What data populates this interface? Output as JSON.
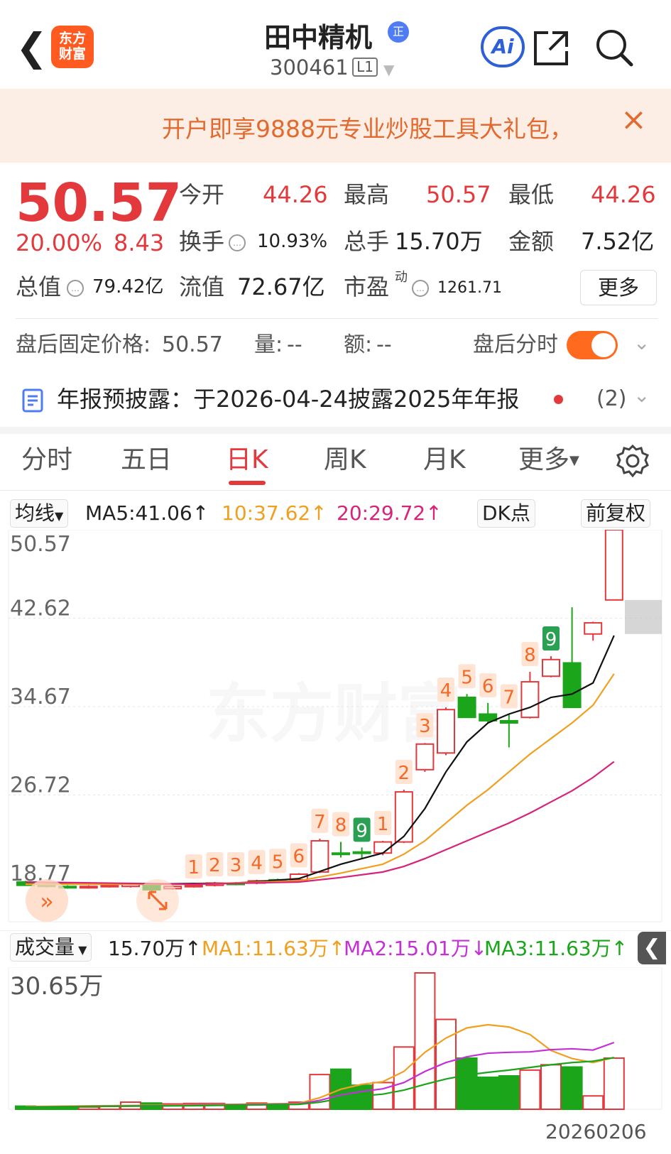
{
  "header": {
    "back_icon": "chevron-left-icon",
    "logo_line1": "东方",
    "logo_line2": "财富",
    "title": "田中精机",
    "badge": "正",
    "code": "300461",
    "level": "L1",
    "ai_label": "Ai",
    "share_icon": "share-icon",
    "search_icon": "search-icon"
  },
  "banner": {
    "text": "开户即享9888元专业炒股工具大礼包，",
    "close": "×"
  },
  "quote": {
    "price": "50.57",
    "change_pct": "20.00%",
    "change": "8.43",
    "open_label": "今开",
    "open": "44.26",
    "high_label": "最高",
    "high": "50.57",
    "low_label": "最低",
    "low": "44.26",
    "turnover_label": "换手",
    "turnover": "10.93%",
    "volume_label": "总手",
    "volume": "15.70万",
    "amount_label": "金额",
    "amount": "7.52亿",
    "mktcap_label": "总值",
    "mktcap": "79.42亿",
    "float_label": "流值",
    "float_cap": "72.67亿",
    "pe_label": "市盈",
    "pe_sup": "动",
    "pe": "1261.71",
    "more": "更多"
  },
  "after_hours": {
    "label": "盘后固定价格:",
    "price": "50.57",
    "vol_label": "量:",
    "vol": "--",
    "amt_label": "额:",
    "amt": "--",
    "timeshare_label": "盘后分时"
  },
  "disclosure": {
    "text": "年报预披露：于2026-04-24披露2025年年报",
    "count": "(2)"
  },
  "tabs": [
    "分时",
    "五日",
    "日K",
    "周K",
    "月K",
    "更多"
  ],
  "ma_bar": {
    "selector": "均线",
    "ma5": "MA5:41.06↑",
    "ma10": "10:37.62↑",
    "ma20": "20:29.72↑",
    "dk": "DK点",
    "adjust": "前复权"
  },
  "vol_bar": {
    "selector": "成交量",
    "current": "15.70万↑",
    "ma1": "MA1:11.63万↑",
    "ma2": "MA2:15.01万↓",
    "ma3": "MA3:11.63万↑"
  },
  "watermark": "东方财富",
  "date": "20260206",
  "colors": {
    "up": "#e4393c",
    "down": "#1aa51a",
    "ma5": "#111111",
    "ma10": "#f0a020",
    "ma20": "#d6247a",
    "seq_up": "#f26a2a",
    "seq_down": "#2aa052"
  },
  "chart_data": {
    "type": "candlestick",
    "y_ticks": [
      "50.57",
      "42.62",
      "34.67",
      "26.72",
      "18.77"
    ],
    "ylim": [
      18.77,
      50.57
    ],
    "vol_tick": "30.65万",
    "vol_max": 30.65,
    "candles": [
      {
        "o": 18.9,
        "h": 19.0,
        "l": 18.6,
        "c": 18.6,
        "v": 0.7,
        "d": 1
      },
      {
        "o": 18.7,
        "h": 18.8,
        "l": 18.4,
        "c": 18.5,
        "v": 0.6,
        "d": 1
      },
      {
        "o": 18.5,
        "h": 18.6,
        "l": 18.3,
        "c": 18.4,
        "v": 0.6,
        "d": 1
      },
      {
        "o": 18.4,
        "h": 18.6,
        "l": 18.3,
        "c": 18.5,
        "v": 0.5,
        "d": 0
      },
      {
        "o": 18.5,
        "h": 18.7,
        "l": 18.4,
        "c": 18.6,
        "v": 0.7,
        "d": 0
      },
      {
        "o": 18.5,
        "h": 18.8,
        "l": 18.4,
        "c": 18.7,
        "v": 1.6,
        "d": 0
      },
      {
        "o": 18.6,
        "h": 18.7,
        "l": 18.1,
        "c": 18.2,
        "v": 1.4,
        "d": 1
      },
      {
        "o": 18.3,
        "h": 18.6,
        "l": 18.2,
        "c": 18.5,
        "v": 1.2,
        "d": 0
      },
      {
        "o": 18.5,
        "h": 18.7,
        "l": 18.4,
        "c": 18.6,
        "v": 1.3,
        "d": 0
      },
      {
        "o": 18.6,
        "h": 18.9,
        "l": 18.5,
        "c": 18.8,
        "v": 1.3,
        "d": 0
      },
      {
        "o": 18.8,
        "h": 18.9,
        "l": 18.6,
        "c": 18.7,
        "v": 1.1,
        "d": 1
      },
      {
        "o": 18.8,
        "h": 19.1,
        "l": 18.7,
        "c": 19.0,
        "v": 1.4,
        "d": 0
      },
      {
        "o": 19.0,
        "h": 19.2,
        "l": 18.9,
        "c": 19.1,
        "v": 1.2,
        "d": 1
      },
      {
        "o": 19.1,
        "h": 19.7,
        "l": 19.0,
        "c": 19.6,
        "v": 1.6,
        "d": 0
      },
      {
        "o": 19.8,
        "h": 22.8,
        "l": 19.7,
        "c": 22.6,
        "v": 7.8,
        "d": 0
      },
      {
        "o": 21.5,
        "h": 22.5,
        "l": 21.1,
        "c": 21.5,
        "v": 9.0,
        "d": 1
      },
      {
        "o": 21.6,
        "h": 22.0,
        "l": 21.0,
        "c": 21.6,
        "v": 5.4,
        "d": 1
      },
      {
        "o": 21.5,
        "h": 22.6,
        "l": 21.3,
        "c": 22.5,
        "v": 6.0,
        "d": 0
      },
      {
        "o": 22.5,
        "h": 27.2,
        "l": 22.4,
        "c": 27.0,
        "v": 14.0,
        "d": 0
      },
      {
        "o": 29.0,
        "h": 31.4,
        "l": 28.8,
        "c": 31.3,
        "v": 30.65,
        "d": 0
      },
      {
        "o": 30.5,
        "h": 34.6,
        "l": 30.3,
        "c": 34.4,
        "v": 20.2,
        "d": 0
      },
      {
        "o": 35.5,
        "h": 35.8,
        "l": 33.7,
        "c": 33.7,
        "v": 11.5,
        "d": 1
      },
      {
        "o": 34.0,
        "h": 35.0,
        "l": 33.2,
        "c": 33.4,
        "v": 7.2,
        "d": 1
      },
      {
        "o": 33.4,
        "h": 34.0,
        "l": 31.0,
        "c": 33.2,
        "v": 7.5,
        "d": 1
      },
      {
        "o": 33.7,
        "h": 37.8,
        "l": 33.6,
        "c": 36.9,
        "v": 8.8,
        "d": 0
      },
      {
        "o": 37.4,
        "h": 39.2,
        "l": 37.3,
        "c": 38.9,
        "v": 10.0,
        "d": 0
      },
      {
        "o": 38.6,
        "h": 43.6,
        "l": 34.6,
        "c": 34.6,
        "v": 9.5,
        "d": 1
      },
      {
        "o": 41.2,
        "h": 42.3,
        "l": 40.6,
        "c": 42.2,
        "v": 3.0,
        "d": 0
      },
      {
        "o": 44.26,
        "h": 50.57,
        "l": 44.26,
        "c": 50.57,
        "v": 11.5,
        "d": 0
      }
    ],
    "labels": [
      {
        "i": 8,
        "t": "1",
        "k": "up"
      },
      {
        "i": 9,
        "t": "2",
        "k": "up"
      },
      {
        "i": 10,
        "t": "3",
        "k": "up"
      },
      {
        "i": 11,
        "t": "4",
        "k": "up"
      },
      {
        "i": 12,
        "t": "5",
        "k": "up"
      },
      {
        "i": 13,
        "t": "6",
        "k": "up"
      },
      {
        "i": 14,
        "t": "7",
        "k": "up"
      },
      {
        "i": 15,
        "t": "8",
        "k": "up"
      },
      {
        "i": 16,
        "t": "9",
        "k": "down"
      },
      {
        "i": 17,
        "t": "1",
        "k": "up"
      },
      {
        "i": 18,
        "t": "2",
        "k": "up"
      },
      {
        "i": 19,
        "t": "3",
        "k": "up"
      },
      {
        "i": 20,
        "t": "4",
        "k": "up"
      },
      {
        "i": 21,
        "t": "5",
        "k": "up"
      },
      {
        "i": 22,
        "t": "6",
        "k": "up"
      },
      {
        "i": 23,
        "t": "7",
        "k": "up"
      },
      {
        "i": 24,
        "t": "8",
        "k": "up"
      },
      {
        "i": 25,
        "t": "9",
        "k": "down"
      }
    ],
    "ma5": [
      [
        0,
        18.9
      ],
      [
        5,
        18.7
      ],
      [
        10,
        18.8
      ],
      [
        13,
        19.2
      ],
      [
        15,
        20.5
      ],
      [
        17,
        21.5
      ],
      [
        18,
        23.0
      ],
      [
        19,
        25.5
      ],
      [
        20,
        28.8
      ],
      [
        21,
        31.5
      ],
      [
        22,
        33.2
      ],
      [
        23,
        34.0
      ],
      [
        24,
        34.6
      ],
      [
        25,
        35.5
      ],
      [
        26,
        35.8
      ],
      [
        27,
        36.8
      ],
      [
        28,
        41.06
      ]
    ],
    "ma10": [
      [
        0,
        18.7
      ],
      [
        8,
        18.7
      ],
      [
        13,
        19.0
      ],
      [
        15,
        19.7
      ],
      [
        17,
        20.5
      ],
      [
        18,
        21.4
      ],
      [
        19,
        22.6
      ],
      [
        20,
        24.2
      ],
      [
        21,
        25.8
      ],
      [
        22,
        27.2
      ],
      [
        23,
        28.8
      ],
      [
        24,
        30.4
      ],
      [
        25,
        31.8
      ],
      [
        26,
        33.2
      ],
      [
        27,
        34.8
      ],
      [
        28,
        37.62
      ]
    ],
    "ma20": [
      [
        0,
        18.9
      ],
      [
        8,
        18.7
      ],
      [
        13,
        18.9
      ],
      [
        15,
        19.3
      ],
      [
        17,
        19.8
      ],
      [
        18,
        20.3
      ],
      [
        19,
        21.0
      ],
      [
        20,
        21.8
      ],
      [
        21,
        22.6
      ],
      [
        22,
        23.4
      ],
      [
        23,
        24.2
      ],
      [
        24,
        25.1
      ],
      [
        25,
        26.1
      ],
      [
        26,
        27.1
      ],
      [
        27,
        28.3
      ],
      [
        28,
        29.72
      ]
    ],
    "vma1": [
      [
        0,
        0.6
      ],
      [
        8,
        1.0
      ],
      [
        13,
        1.3
      ],
      [
        14,
        2.6
      ],
      [
        15,
        4.5
      ],
      [
        16,
        5.6
      ],
      [
        17,
        6.2
      ],
      [
        18,
        8.5
      ],
      [
        19,
        12.8
      ],
      [
        20,
        16.0
      ],
      [
        21,
        18.3
      ],
      [
        22,
        19.0
      ],
      [
        23,
        18.5
      ],
      [
        24,
        16.8
      ],
      [
        25,
        13.2
      ],
      [
        26,
        11.4
      ],
      [
        27,
        10.5
      ],
      [
        28,
        11.63
      ]
    ],
    "vma2": [
      [
        0,
        0.5
      ],
      [
        8,
        0.9
      ],
      [
        13,
        1.2
      ],
      [
        14,
        2.0
      ],
      [
        15,
        3.2
      ],
      [
        16,
        4.0
      ],
      [
        17,
        4.6
      ],
      [
        18,
        6.0
      ],
      [
        19,
        8.5
      ],
      [
        20,
        10.5
      ],
      [
        21,
        11.8
      ],
      [
        22,
        12.6
      ],
      [
        23,
        12.8
      ],
      [
        24,
        12.9
      ],
      [
        25,
        13.4
      ],
      [
        26,
        13.6
      ],
      [
        27,
        13.3
      ],
      [
        28,
        15.01
      ]
    ],
    "vma3": [
      [
        0,
        0.5
      ],
      [
        8,
        0.8
      ],
      [
        13,
        1.1
      ],
      [
        14,
        1.6
      ],
      [
        15,
        2.4
      ],
      [
        16,
        3.0
      ],
      [
        17,
        3.4
      ],
      [
        18,
        4.3
      ],
      [
        19,
        5.6
      ],
      [
        20,
        6.8
      ],
      [
        21,
        7.7
      ],
      [
        22,
        8.3
      ],
      [
        23,
        8.8
      ],
      [
        24,
        9.4
      ],
      [
        25,
        10.0
      ],
      [
        26,
        10.5
      ],
      [
        27,
        10.8
      ],
      [
        28,
        11.63
      ]
    ]
  }
}
